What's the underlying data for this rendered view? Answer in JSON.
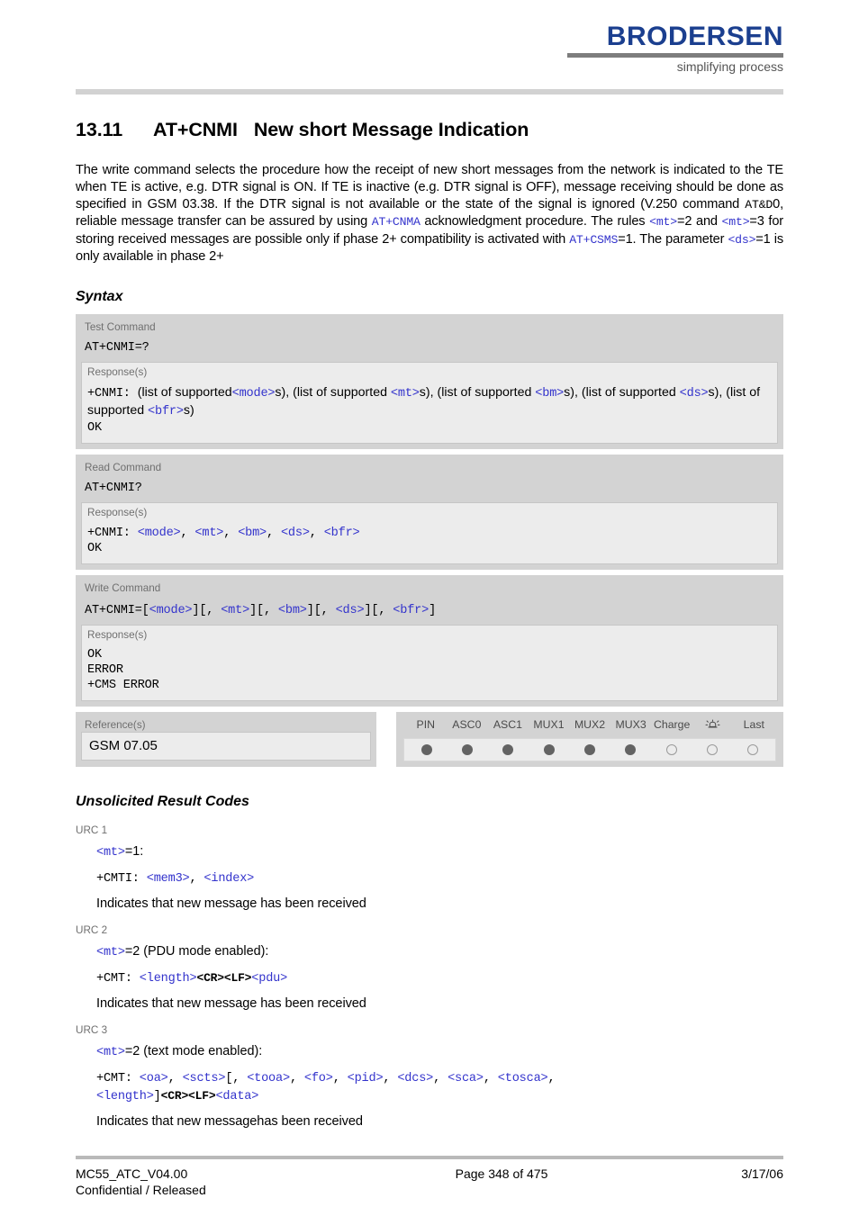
{
  "header": {
    "brand": "BRODERSEN",
    "tagline": "simplifying process"
  },
  "section": {
    "number": "13.11",
    "command": "AT+CNMI",
    "title": "New short Message Indication"
  },
  "intro": {
    "p1": "The write command selects the procedure how the receipt of new short messages from the network is indicated to the TE when TE is active, e.g. DTR signal is ON. If TE is inactive (e.g. DTR signal is OFF), message receiving should be done as specified in GSM 03.38. If the DTR signal is not available or the state of the signal is ignored (V.250 command ",
    "at_d": "AT&D",
    "p2": "0, reliable message transfer can be assured by using ",
    "at_cnma": "AT+CNMA",
    "p3": " acknowledgment procedure. The rules ",
    "mt1": "<mt>",
    "p4": "=2 and ",
    "mt2": "<mt>",
    "p5": "=3 for storing received messages are possible only if phase 2+ compatibility is activated with ",
    "at_csms": "AT+CSMS",
    "p6": "=1. The parameter ",
    "ds": "<ds>",
    "p7": "=1 is only available in phase 2+"
  },
  "headings": {
    "syntax": "Syntax",
    "urc": "Unsolicited Result Codes"
  },
  "syntax": {
    "test": {
      "label": "Test Command",
      "command": "AT+CNMI=?",
      "response_label": "Response(s)",
      "resp_prefix": "+CNMI:",
      "resp_t1": "(list of supported",
      "resp_mode": "<mode>",
      "resp_t2": "s), (list of supported ",
      "resp_mt": "<mt>",
      "resp_t3": "s), (list of supported ",
      "resp_bm": "<bm>",
      "resp_t4": "s), (list of supported ",
      "resp_ds": "<ds>",
      "resp_t5": "s), (list of supported ",
      "resp_bfr": "<bfr>",
      "resp_t6": "s)",
      "ok": "OK"
    },
    "read": {
      "label": "Read Command",
      "command": "AT+CNMI?",
      "response_label": "Response(s)",
      "resp_prefix": "+CNMI:",
      "mode": "<mode>",
      "mt": "<mt>",
      "bm": "<bm>",
      "ds": "<ds>",
      "bfr": "<bfr>",
      "sep": ", ",
      "ok": "OK"
    },
    "write": {
      "label": "Write Command",
      "command_prefix": "AT+CNMI=[",
      "mode": "<mode>",
      "b1": "][, ",
      "mt": "<mt>",
      "b2": "][, ",
      "bm": "<bm>",
      "b3": "][, ",
      "ds": "<ds>",
      "b4": "][, ",
      "bfr": "<bfr>",
      "b5": "]",
      "response_label": "Response(s)",
      "ok": "OK",
      "error": "ERROR",
      "cms_error": "+CMS ERROR"
    }
  },
  "reference": {
    "label": "Reference(s)",
    "value": "GSM 07.05"
  },
  "indicators": {
    "columns": [
      {
        "label": "PIN",
        "state": "filled",
        "icon": null
      },
      {
        "label": "ASC0",
        "state": "filled",
        "icon": null
      },
      {
        "label": "ASC1",
        "state": "filled",
        "icon": null
      },
      {
        "label": "MUX1",
        "state": "filled",
        "icon": null
      },
      {
        "label": "MUX2",
        "state": "filled",
        "icon": null
      },
      {
        "label": "MUX3",
        "state": "filled",
        "icon": null
      },
      {
        "label": "Charge",
        "state": "hollow",
        "icon": null
      },
      {
        "label": "",
        "state": "hollow",
        "icon": "alarm-bell-icon"
      },
      {
        "label": "Last",
        "state": "hollow",
        "icon": null
      }
    ]
  },
  "urcs": [
    {
      "label": "URC 1",
      "mt": "<mt>",
      "mode_text": "=1:",
      "code_prefix": "+CMTI:",
      "code_params": [
        "<mem3>",
        "<index>"
      ],
      "description": "Indicates that new message has been received"
    },
    {
      "label": "URC 2",
      "mt": "<mt>",
      "mode_text": "=2 (PDU mode enabled):",
      "code_prefix": "+CMT:",
      "length": "<length>",
      "cr": "<CR>",
      "lf": "<LF>",
      "pdu": "<pdu>",
      "description": "Indicates that new message has been received"
    },
    {
      "label": "URC 3",
      "mt": "<mt>",
      "mode_text": "=2 (text mode enabled):",
      "code_prefix": "+CMT:",
      "oa": "<oa>",
      "scts": "<scts>",
      "bracket_open": "[, ",
      "tooa": "<tooa>",
      "fo": "<fo>",
      "pid": "<pid>",
      "dcs": "<dcs>",
      "sca": "<sca>",
      "tosca": "<tosca>",
      "length": "<length>",
      "bracket_close": "]",
      "cr": "<CR>",
      "lf": "<LF>",
      "data": "<data>",
      "description": "Indicates that new messagehas been received"
    }
  ],
  "footer": {
    "doc_id": "MC55_ATC_V04.00",
    "classification": "Confidential / Released",
    "page": "Page 348 of 475",
    "date": "3/17/06"
  },
  "colors": {
    "brand_blue": "#1b3f8f",
    "tag_blue": "#3333cc",
    "box_gray": "#d3d3d3",
    "panel_gray": "#ececec"
  }
}
